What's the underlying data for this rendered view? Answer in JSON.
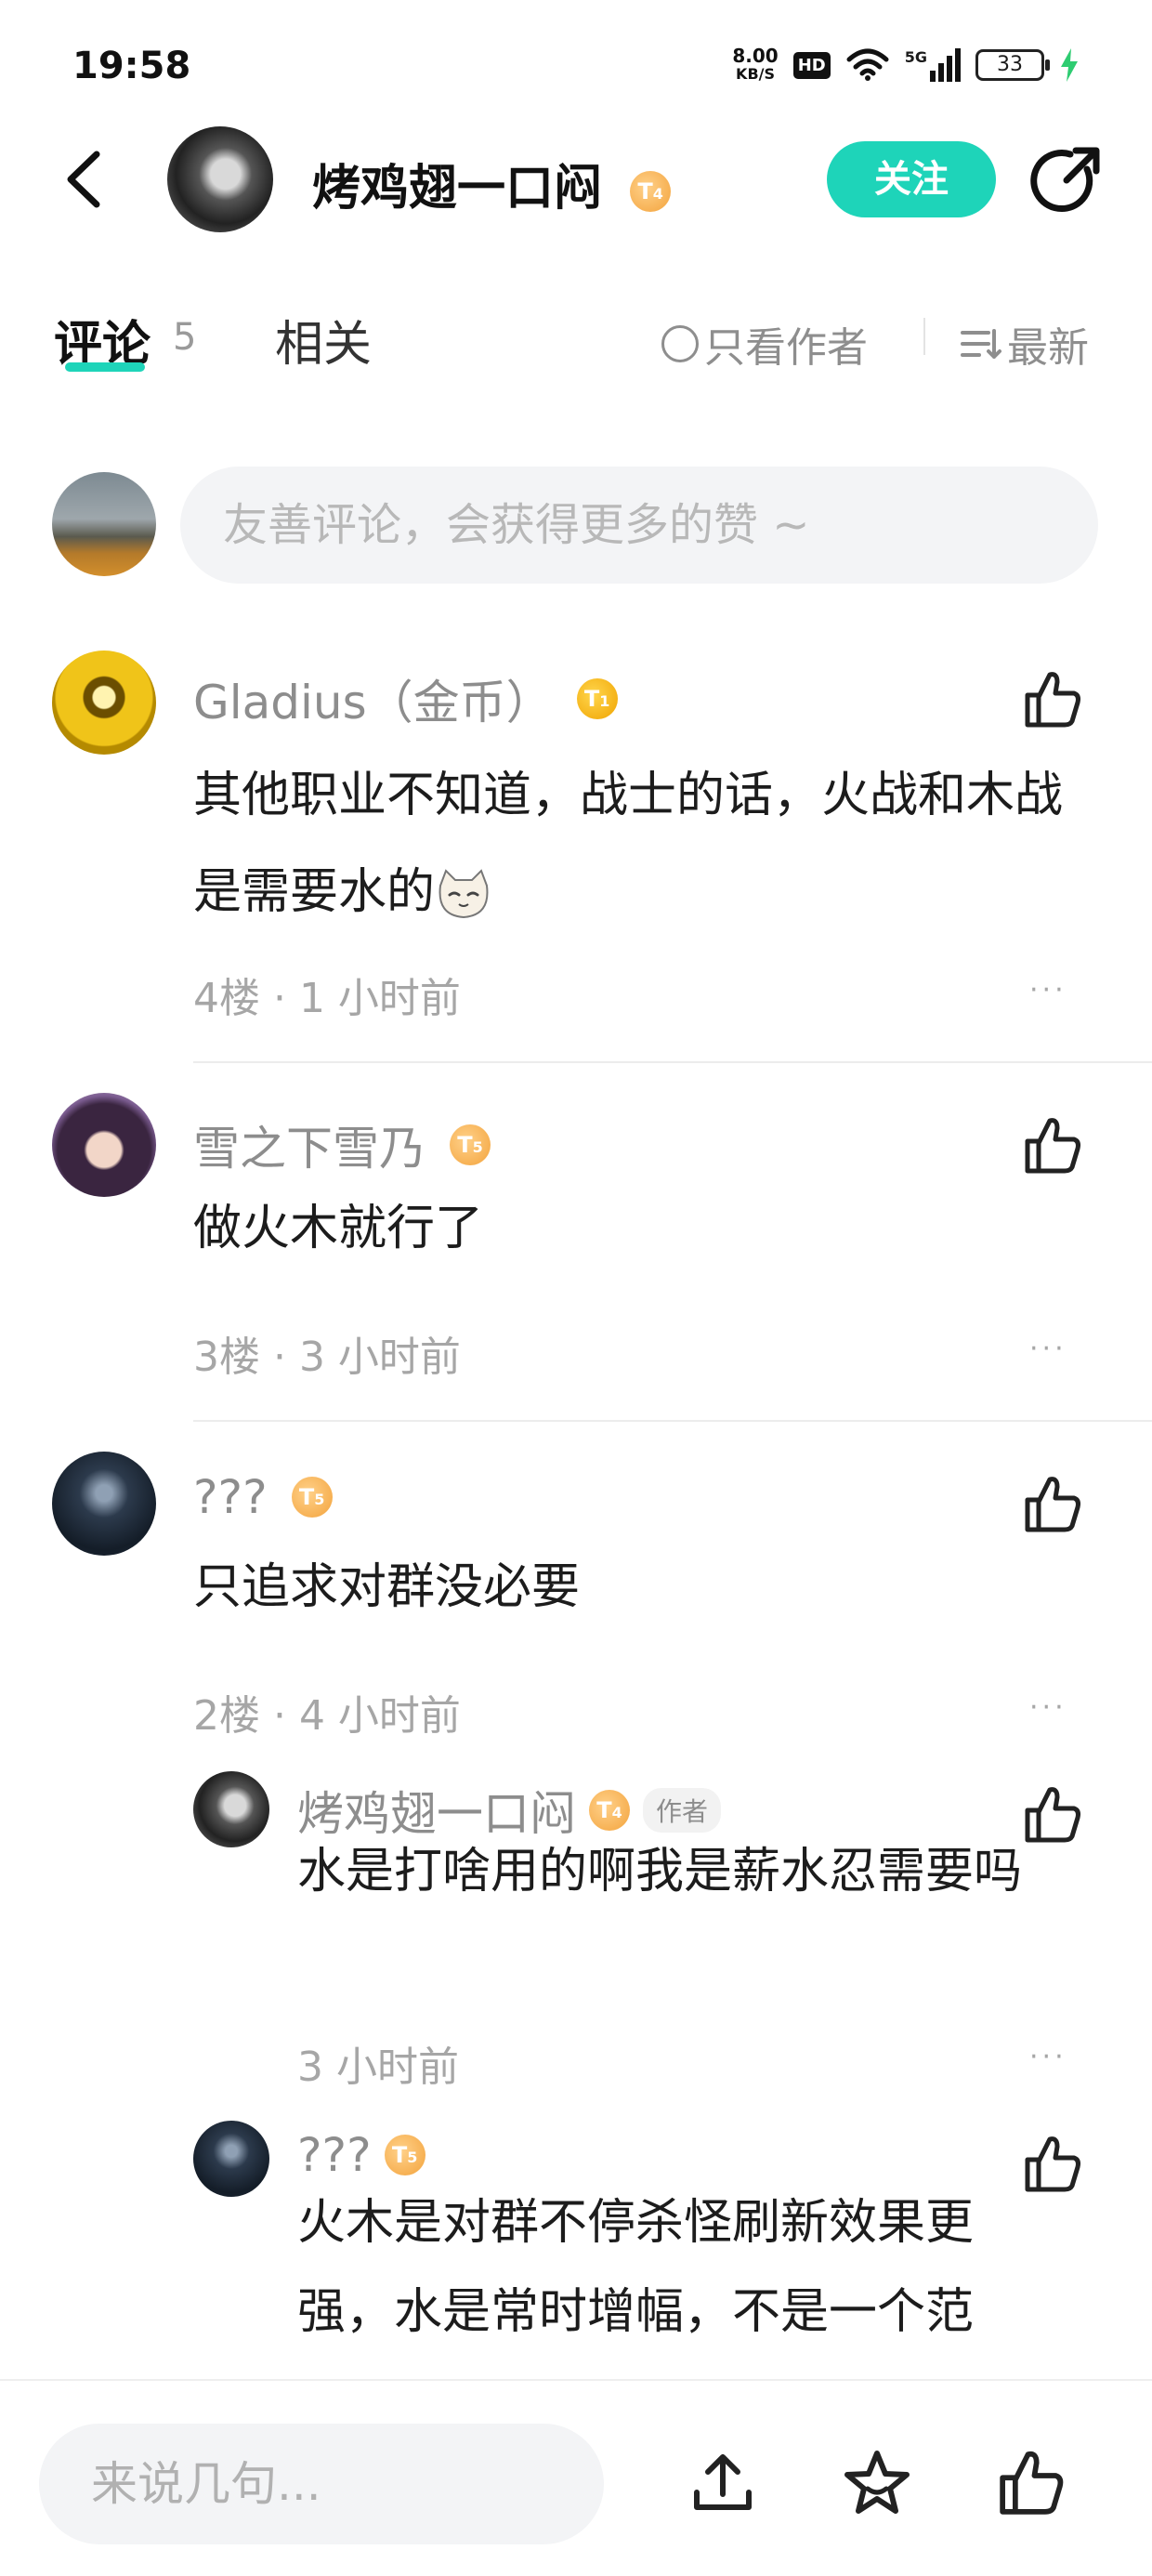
{
  "status_bar": {
    "time": "19:58",
    "net_speed_value": "8.00",
    "net_speed_unit": "KB/S",
    "hd": "HD",
    "signal": "5G",
    "battery": "33"
  },
  "header": {
    "author_name": "烤鸡翅一口闷",
    "author_level": "4",
    "follow_label": "关注"
  },
  "tabs": {
    "comments_label": "评论",
    "comments_count": "5",
    "related_label": "相关",
    "author_only_label": "只看作者",
    "sort_label": "最新"
  },
  "comment_box": {
    "placeholder": "友善评论，会获得更多的赞 ~"
  },
  "comments": [
    {
      "name": "Gladius（金币）",
      "level": "1",
      "text": "其他职业不知道，战士的话，火战和木战是需要水的",
      "meta": "4楼 · 1 小时前"
    },
    {
      "name": "雪之下雪乃",
      "level": "5",
      "text": "做火木就行了",
      "meta": "3楼 · 3 小时前"
    },
    {
      "name": "???",
      "level": "5",
      "text": "只追求对群没必要",
      "meta": "2楼 · 4 小时前",
      "replies": [
        {
          "name": "烤鸡翅一口闷",
          "level": "4",
          "tag": "作者",
          "text": "水是打啥用的啊我是薪水忍需要吗",
          "meta": "3 小时前"
        },
        {
          "name": "???",
          "level": "5",
          "text": "火木是对群不停杀怪刷新效果更强，水是常时增幅，不是一个范"
        }
      ]
    }
  ],
  "more_glyph": "···",
  "bottom_bar": {
    "input_placeholder": "来说几句..."
  },
  "colors": {
    "accent": "#1ed4b9",
    "level_badge": "#f3a33c",
    "secondary_text": "#8d8d8d"
  },
  "icons": [
    "back-arrow-icon",
    "share-icon",
    "radio-circle-icon",
    "sort-icon",
    "thumbs-up-icon",
    "more-dots-icon",
    "upload-icon",
    "star-icon",
    "cat-emoji-icon"
  ]
}
